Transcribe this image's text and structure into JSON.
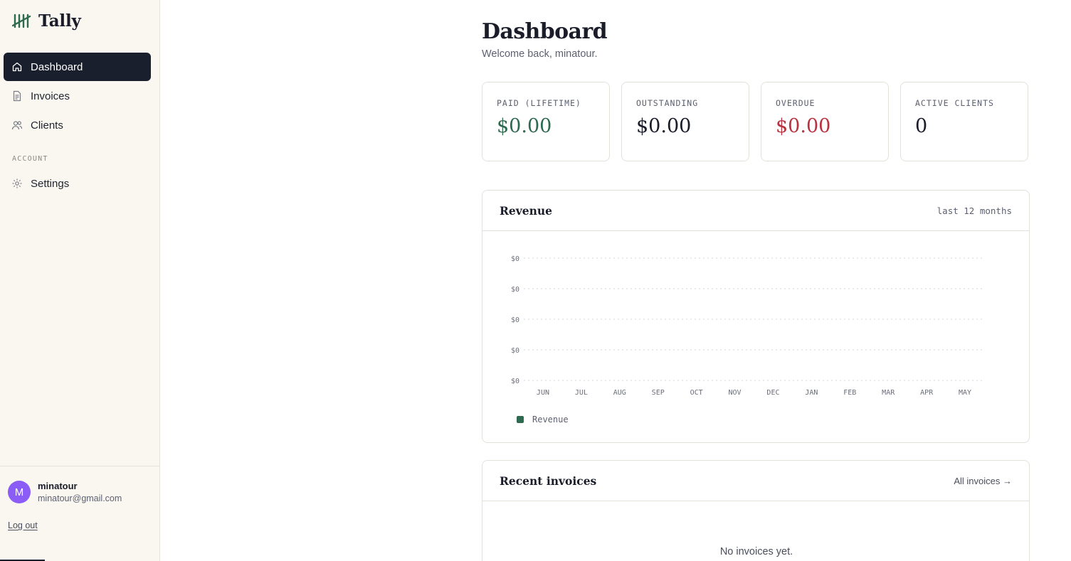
{
  "app": {
    "name": "Tally"
  },
  "nav": {
    "items": [
      {
        "label": "Dashboard",
        "icon": "home-icon",
        "active": true
      },
      {
        "label": "Invoices",
        "icon": "document-icon",
        "active": false
      },
      {
        "label": "Clients",
        "icon": "users-icon",
        "active": false
      }
    ],
    "account_section": "ACCOUNT",
    "settings": {
      "label": "Settings",
      "icon": "gear-icon"
    }
  },
  "user": {
    "initial": "M",
    "name": "minatour",
    "email": "minatour@gmail.com",
    "logout_label": "Log out",
    "avatar_color": "#8b5cf6"
  },
  "page": {
    "title": "Dashboard",
    "subtitle": "Welcome back, minatour."
  },
  "stats": [
    {
      "label": "PAID (LIFETIME)",
      "value": "$0.00",
      "tone": "green"
    },
    {
      "label": "OUTSTANDING",
      "value": "$0.00",
      "tone": "default"
    },
    {
      "label": "OVERDUE",
      "value": "$0.00",
      "tone": "red"
    },
    {
      "label": "ACTIVE CLIENTS",
      "value": "0",
      "tone": "default"
    }
  ],
  "revenue": {
    "title": "Revenue",
    "range": "last 12 months"
  },
  "chart_data": {
    "type": "bar",
    "categories": [
      "JUN",
      "JUL",
      "AUG",
      "SEP",
      "OCT",
      "NOV",
      "DEC",
      "JAN",
      "FEB",
      "MAR",
      "APR",
      "MAY"
    ],
    "series": [
      {
        "name": "Revenue",
        "values": [
          0,
          0,
          0,
          0,
          0,
          0,
          0,
          0,
          0,
          0,
          0,
          0
        ]
      }
    ],
    "y_tick_labels": [
      "$0",
      "$0",
      "$0",
      "$0",
      "$0"
    ],
    "ylim": [
      0,
      0
    ],
    "grid": true,
    "legend": "bottom-left",
    "color": "#2d6a4f"
  },
  "recent": {
    "title": "Recent invoices",
    "link_label": "All invoices →",
    "empty_text": "No invoices yet."
  },
  "colors": {
    "accent_green": "#2d6a4f",
    "alert_red": "#b8323f",
    "nav_active_bg": "#1a1f2e",
    "sidebar_bg": "#faf7f0"
  }
}
